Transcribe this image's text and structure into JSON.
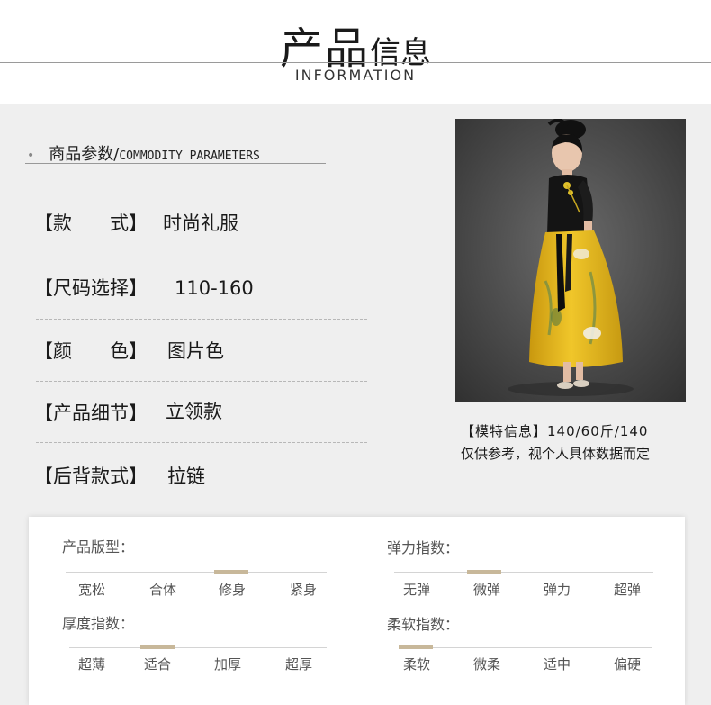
{
  "header": {
    "title_big": "产品",
    "title_small": "信息",
    "subtitle": "INFORMATION"
  },
  "section": {
    "bullet": "•",
    "title_cn": "商品参数/",
    "title_en": "COMMODITY PARAMETERS"
  },
  "params": [
    {
      "label": "【款　　式】",
      "value": "时尚礼服"
    },
    {
      "label": "【尺码选择】",
      "value": "110-160"
    },
    {
      "label": "【颜　　色】",
      "value": "图片色"
    },
    {
      "label": "【产品细节】",
      "value": "立领款"
    },
    {
      "label": "【后背款式】",
      "value": "拉链"
    }
  ],
  "model": {
    "info": "【模特信息】140/60斤/140",
    "note": "仅供参考，视个人具体数据而定"
  },
  "scales": [
    {
      "title": "产品版型：",
      "options": [
        "宽松",
        "合体",
        "修身",
        "紧身"
      ],
      "selected": 2
    },
    {
      "title": "弹力指数：",
      "options": [
        "无弹",
        "微弹",
        "弹力",
        "超弹"
      ],
      "selected": 1
    },
    {
      "title": "厚度指数：",
      "options": [
        "超薄",
        "适合",
        "加厚",
        "超厚"
      ],
      "selected": 1
    },
    {
      "title": "柔软指数：",
      "options": [
        "柔软",
        "微柔",
        "适中",
        "偏硬"
      ],
      "selected": 0
    }
  ],
  "colors": {
    "marker": "#c8b89a",
    "dress_yellow": "#e2b51a",
    "panel": "#efefef"
  }
}
